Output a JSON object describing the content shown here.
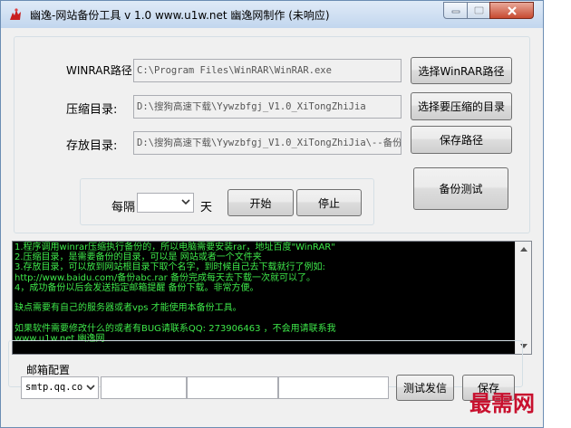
{
  "window": {
    "title": "幽逸-网站备份工具 v 1.0 www.u1w.net 幽逸网制作 (未响应)"
  },
  "form": {
    "winrar_label": "WINRAR路径:",
    "winrar_path": "C:\\Program Files\\WinRAR\\WinRAR.exe",
    "select_winrar_button": "选择WinRAR路径",
    "compress_label": "压缩目录:",
    "compress_path": "D:\\搜狗高速下载\\Yywzbfgj_V1.0_XiTongZhiJia",
    "select_compress_button": "选择要压缩的目录",
    "store_label": "存放目录:",
    "store_path": "D:\\搜狗高速下载\\Yywzbfgj_V1.0_XiTongZhiJia\\--备份",
    "save_path_button": "保存路径",
    "backup_test_button": "备份测试"
  },
  "schedule": {
    "every_label": "每隔",
    "interval_value": "",
    "unit_label": "天",
    "start_button": "开始",
    "stop_button": "停止"
  },
  "console": {
    "lines": [
      "1.程序调用winrar压缩执行备份的，所以电脑需要安装rar，地址百度\"WinRAR\"",
      "2.压缩目录，是需要备份的目录，可以是 网站或者一个文件夹",
      "3.存放目录，可以放到网站根目录下取个名字，到时候自己去下载就行了例如:",
      "http://www.baidu.com/备份abc.rar 备份完成每天去下载一次就可以了。",
      "4，成功备份以后会发送指定邮箱提醒 备份下载。非常方便。",
      "",
      " 缺点需要有自己的服务器或者vps 才能使用本备份工具。",
      "",
      "如果软件需要修改什么的或者有BUG请联系QQ: 273906463 ，不会用请联系我",
      "www.u1w.net 幽逸网"
    ]
  },
  "mail": {
    "group_label": "邮箱配置",
    "smtp_value": "smtp.qq.co",
    "field1": "",
    "field2": "",
    "field3": "",
    "test_send_button": "测试发信",
    "save_button": "保存"
  },
  "watermark": "最需网",
  "colors": {
    "console_text": "#3ee84a",
    "console_bg": "#000000",
    "watermark": "#c8102e"
  }
}
